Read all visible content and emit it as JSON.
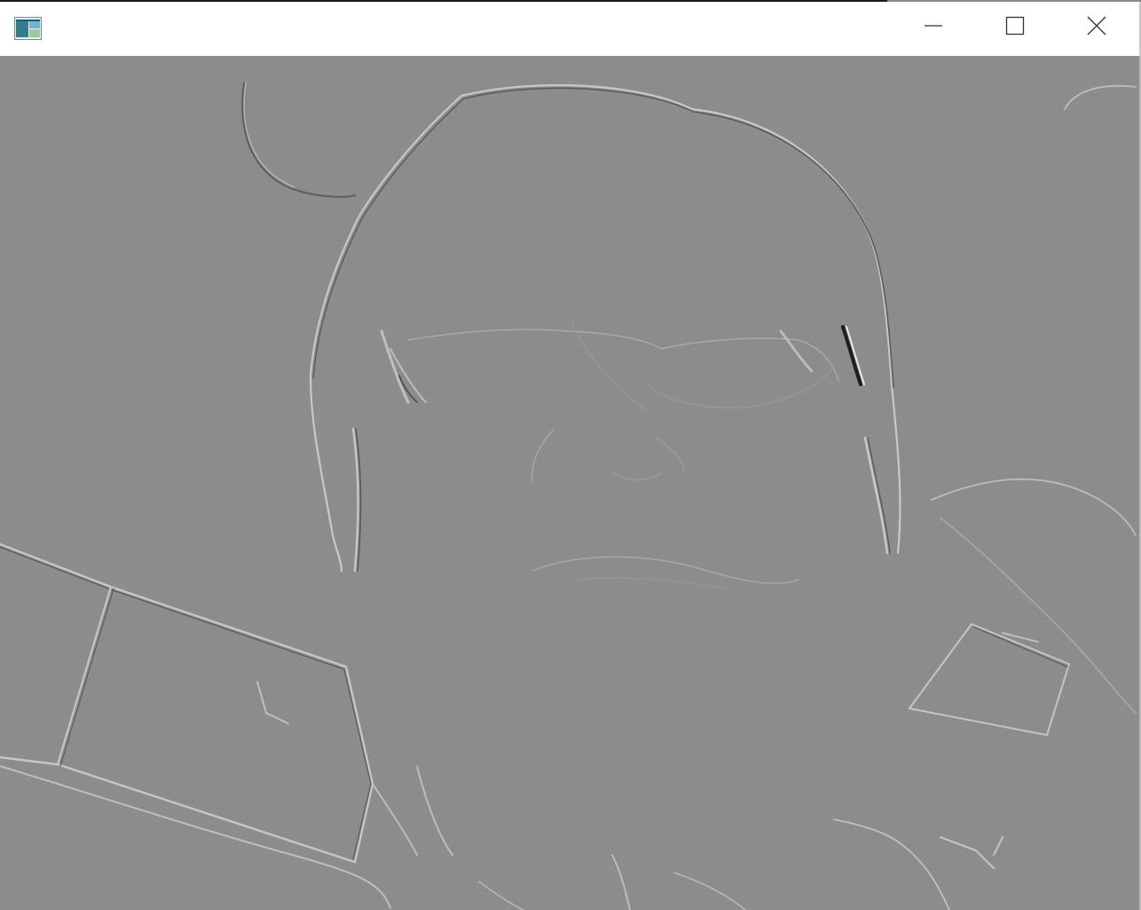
{
  "window": {
    "title": "",
    "icon": "app-window-icon",
    "controls": {
      "minimize_icon": "minimize-icon",
      "maximize_icon": "maximize-icon",
      "close_icon": "close-icon"
    }
  },
  "viewport": {
    "content": "embossed-edge-filter-camera-frame",
    "background_color": "#8b8a89",
    "edge_highlight_color": "#c9c9c9",
    "edge_shadow_color": "#5e5e5e"
  }
}
